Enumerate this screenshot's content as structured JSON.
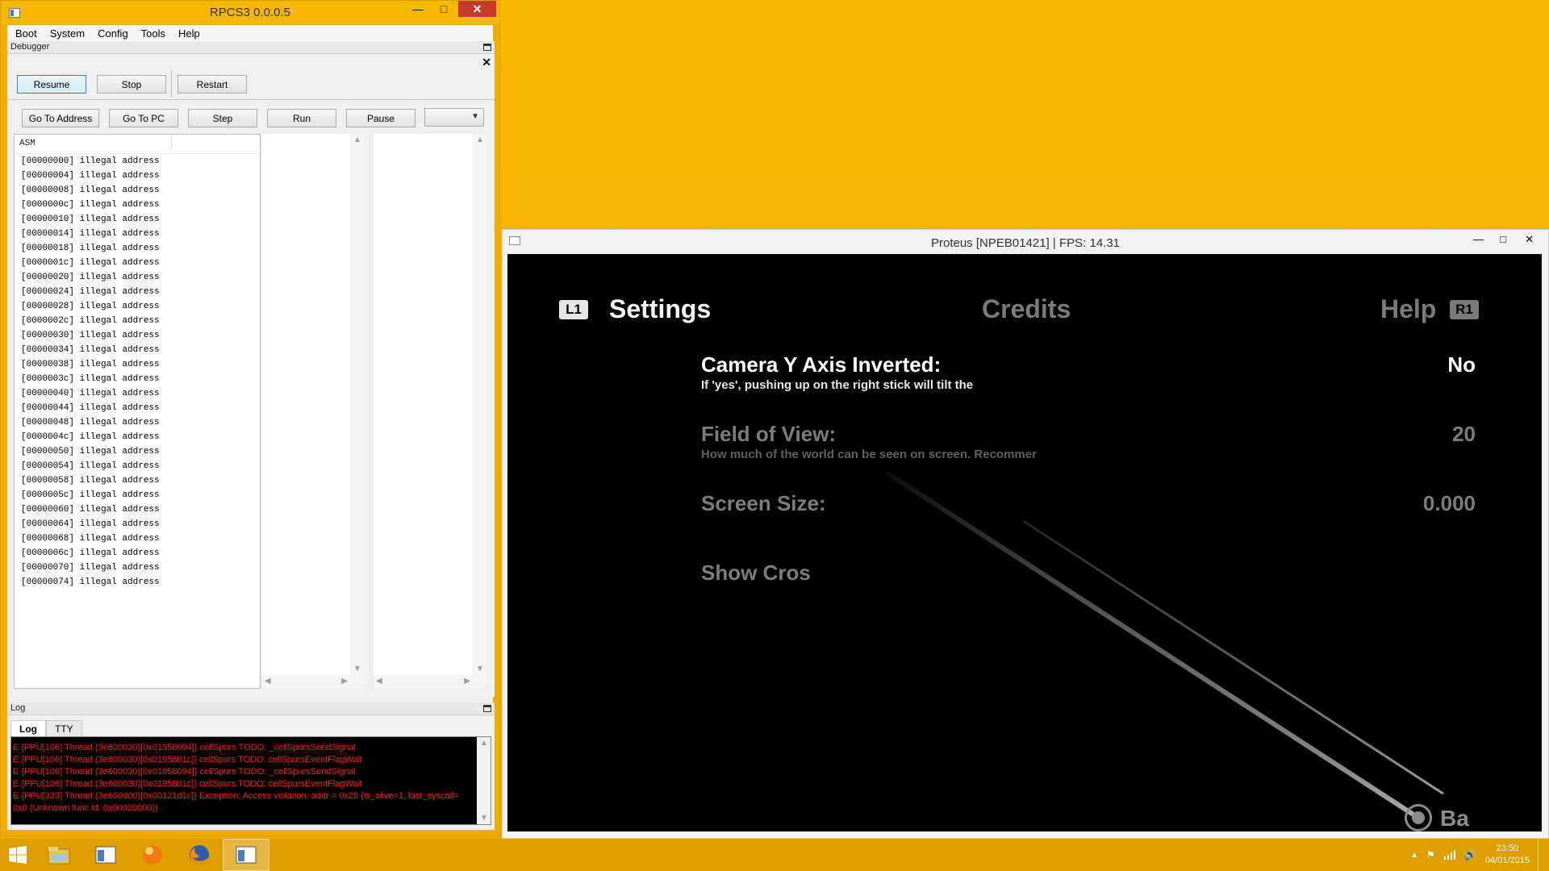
{
  "rpcs3": {
    "title": "RPCS3 0.0.0.5",
    "menu": [
      "Boot",
      "System",
      "Config",
      "Tools",
      "Help"
    ],
    "debugger": {
      "dock_title": "Debugger",
      "buttons_row1": {
        "resume": "Resume",
        "stop": "Stop",
        "restart": "Restart"
      },
      "buttons_row2": {
        "go_to_address": "Go To Address",
        "go_to_pc": "Go To PC",
        "step": "Step",
        "run": "Run",
        "pause": "Pause"
      },
      "thread_select": "",
      "asm_header": "ASM",
      "asm_lines": [
        "[00000000] illegal address",
        "[00000004] illegal address",
        "[00000008] illegal address",
        "[0000000c] illegal address",
        "[00000010] illegal address",
        "[00000014] illegal address",
        "[00000018] illegal address",
        "[0000001c] illegal address",
        "[00000020] illegal address",
        "[00000024] illegal address",
        "[00000028] illegal address",
        "[0000002c] illegal address",
        "[00000030] illegal address",
        "[00000034] illegal address",
        "[00000038] illegal address",
        "[0000003c] illegal address",
        "[00000040] illegal address",
        "[00000044] illegal address",
        "[00000048] illegal address",
        "[0000004c] illegal address",
        "[00000050] illegal address",
        "[00000054] illegal address",
        "[00000058] illegal address",
        "[0000005c] illegal address",
        "[00000060] illegal address",
        "[00000064] illegal address",
        "[00000068] illegal address",
        "[0000006c] illegal address",
        "[00000070] illegal address",
        "[00000074] illegal address"
      ]
    },
    "log": {
      "dock_title": "Log",
      "tabs": [
        "Log",
        "TTY"
      ],
      "lines": [
        "E {PPU[106] Thread (3e600030)[0x01958094]} cellSpurs TODO: _cellSpursSendSignal",
        "E {PPU[106] Thread (3e600030)[0x0195801c]} cellSpurs TODO: cellSpursEventFlagWait",
        "E {PPU[106] Thread (3e600030)[0x01958094]} cellSpurs TODO: _cellSpursSendSignal",
        "E {PPU[106] Thread (3e600030)[0x0195801c]} cellSpurs TODO: cellSpursEventFlagWait",
        "E {PPU[333] Thread (3e600d00)[0x00121d1c]} Exception: Access violation: addr = 0x28 (is_alive=1, last_syscall=",
        "0x0 (Unknown func id: 0x00000000))"
      ]
    }
  },
  "game": {
    "title": "Proteus [NPEB01421] | FPS: 14.31",
    "tabs": {
      "left_badge": "L1",
      "settings": "Settings",
      "credits": "Credits",
      "help": "Help",
      "right_badge": "R1"
    },
    "options": [
      {
        "label": "Camera Y Axis Inverted:",
        "desc": "If 'yes', pushing up on the right stick will tilt the",
        "value": "No"
      },
      {
        "label": "Field of View:",
        "desc": "How much of the world can be seen on screen. Recommer",
        "value": "20"
      },
      {
        "label": "Screen Size:",
        "desc": "",
        "value": "0.000"
      },
      {
        "label": "Show Cros",
        "desc": "",
        "value": ""
      }
    ],
    "back_label": "Ba"
  },
  "taskbar": {
    "time": "23:50",
    "date": "04/01/2015"
  }
}
